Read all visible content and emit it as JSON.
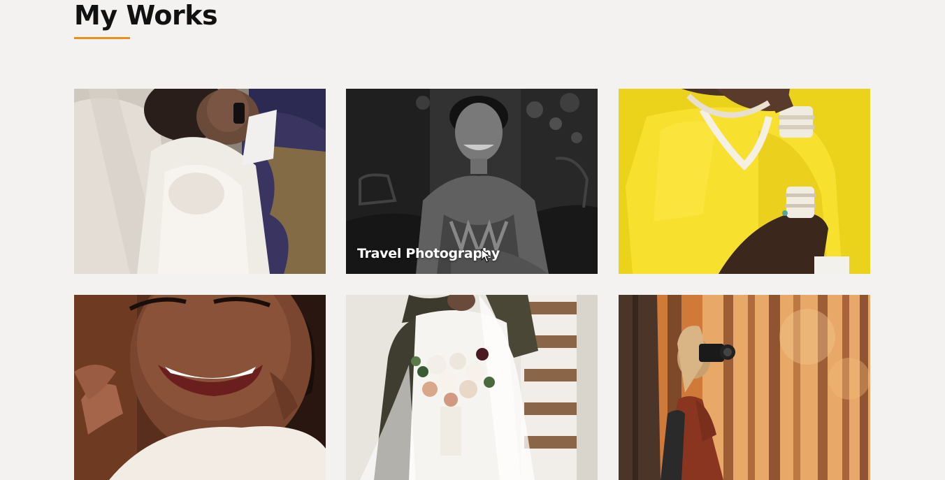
{
  "section": {
    "title": "My Works"
  },
  "colors": {
    "background": "#f3f2f0",
    "accent": "#e8901a",
    "title": "#111111"
  },
  "gallery": {
    "items": [
      {
        "subject": "wedding-couple-photo",
        "caption": ""
      },
      {
        "subject": "woman-smiling-bw-photo",
        "caption": "Travel Photography",
        "hovered": true
      },
      {
        "subject": "yellow-shirt-jewelry-photo",
        "caption": ""
      },
      {
        "subject": "laughing-woman-photo",
        "caption": ""
      },
      {
        "subject": "bride-bouquet-photo",
        "caption": ""
      },
      {
        "subject": "photographer-forest-photo",
        "caption": ""
      }
    ]
  }
}
